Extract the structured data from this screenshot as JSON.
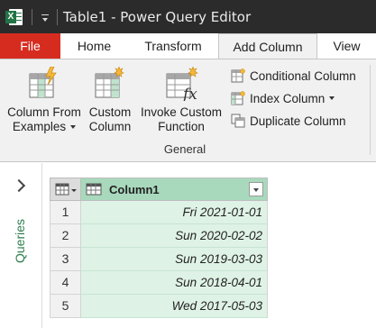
{
  "window": {
    "title": "Table1 - Power Query Editor",
    "app_icon": "excel-icon"
  },
  "tabs": [
    {
      "label": "File"
    },
    {
      "label": "Home"
    },
    {
      "label": "Transform"
    },
    {
      "label": "Add Column"
    },
    {
      "label": "View"
    }
  ],
  "ribbon": {
    "column_from_examples": {
      "line1": "Column From",
      "line2": "Examples"
    },
    "custom_column": {
      "line1": "Custom",
      "line2": "Column"
    },
    "invoke_custom_function": {
      "line1": "Invoke Custom",
      "line2": "Function"
    },
    "conditional_column": "Conditional Column",
    "index_column": "Index Column",
    "duplicate_column": "Duplicate Column",
    "group_label": "General"
  },
  "queries_pane": {
    "label": "Queries"
  },
  "table": {
    "column_header": "Column1",
    "rows": [
      {
        "num": "1",
        "value": "Fri 2021-01-01"
      },
      {
        "num": "2",
        "value": "Sun 2020-02-02"
      },
      {
        "num": "3",
        "value": "Sun 2019-03-03"
      },
      {
        "num": "4",
        "value": "Sun 2018-04-01"
      },
      {
        "num": "5",
        "value": "Wed 2017-05-03"
      }
    ]
  },
  "colors": {
    "file_tab": "#d62c20",
    "header_green": "#a9d9bd",
    "cell_green": "#dff2e6",
    "title_bar": "#2b2b2b",
    "accent_green": "#217346"
  }
}
